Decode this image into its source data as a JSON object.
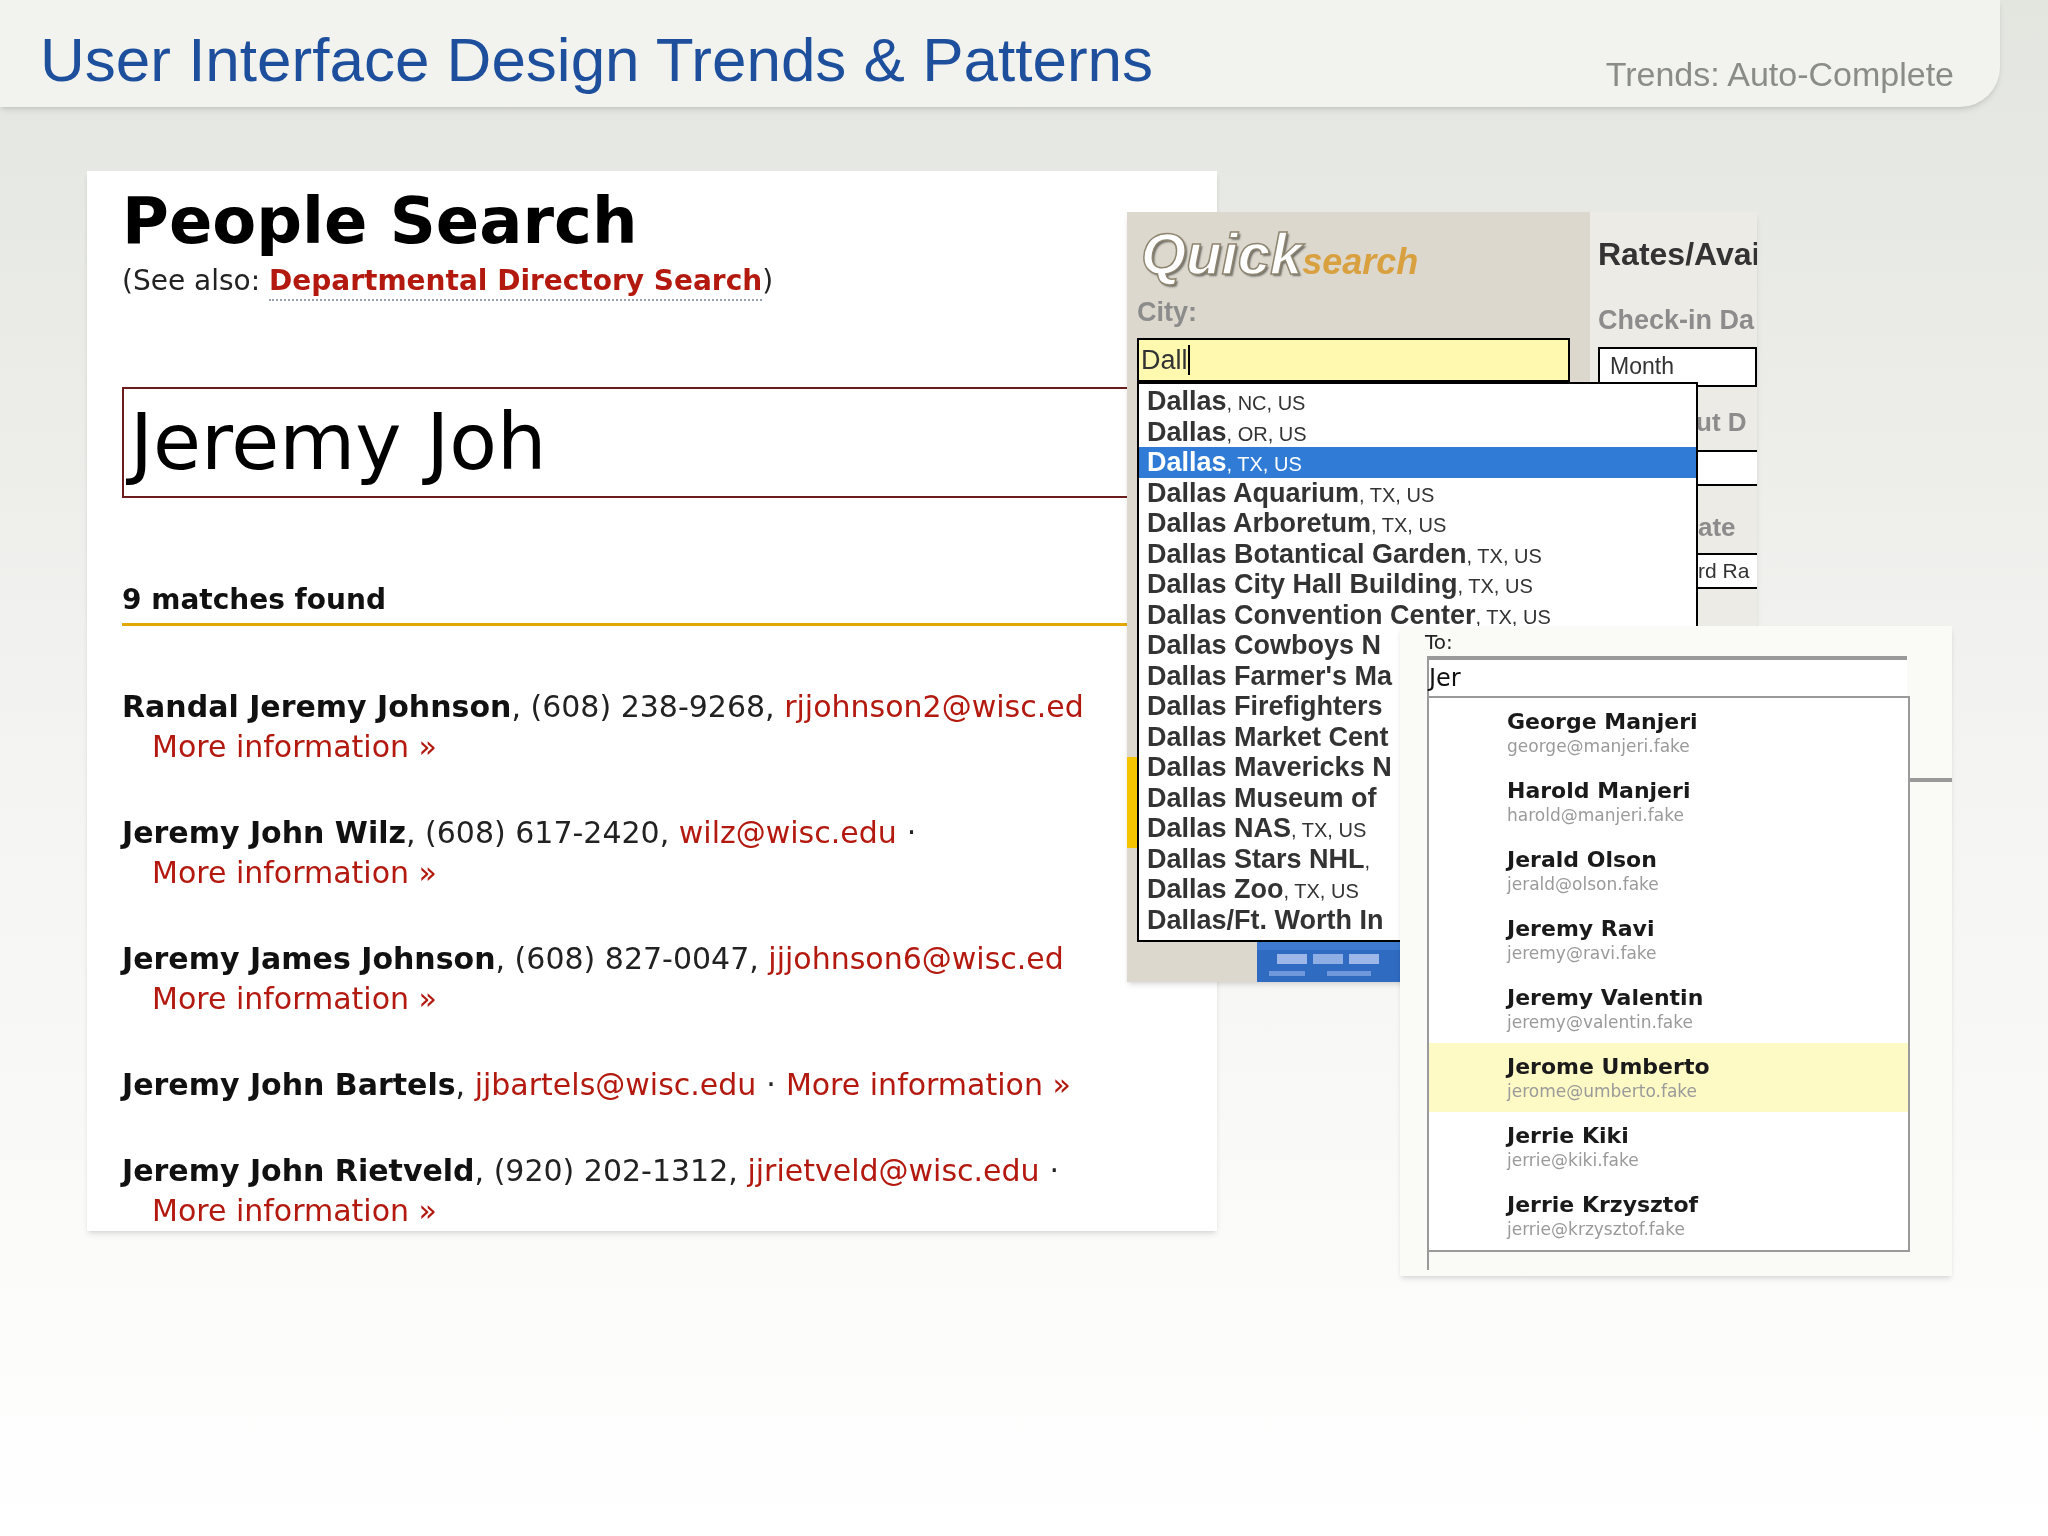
{
  "slide": {
    "title": "User Interface Design Trends & Patterns",
    "subtitle": "Trends: Auto-Complete"
  },
  "people_search": {
    "heading": "People Search",
    "see_also_open": "(See also: ",
    "see_also_link": "Departmental Directory Search",
    "see_also_close": ")",
    "query": "Jeremy Joh",
    "match_count": "9 matches found",
    "results": [
      {
        "name": "Randal Jeremy Johnson",
        "details": ", (608) 238-9268, ",
        "email": "rjjohnson2@wisc.ed",
        "more": "More information »",
        "more_on_new_line": true
      },
      {
        "name": "Jeremy John Wilz",
        "details": ", (608) 617-2420, ",
        "email": "wilz@wisc.edu",
        "separator": "·",
        "more": "More information »",
        "more_on_new_line": true
      },
      {
        "name": "Jeremy James Johnson",
        "details": ", (608) 827-0047, ",
        "email": "jjjohnson6@wisc.ed",
        "more": "More information »",
        "more_on_new_line": true
      },
      {
        "name": "Jeremy John Bartels",
        "details": ", ",
        "email": "jjbartels@wisc.edu",
        "separator": "·",
        "more": "More information »",
        "more_on_new_line": false
      },
      {
        "name": "Jeremy John Rietveld",
        "details": ", (920) 202-1312, ",
        "email": "jjrietveld@wisc.edu",
        "separator": "·",
        "more": "More information »",
        "more_on_new_line": true
      }
    ]
  },
  "quick_search": {
    "logo_main": "Quick",
    "logo_sub": "search",
    "city_label": "City:",
    "city_value": "Dall",
    "suggestions": [
      {
        "place": "Dallas",
        "region": ", NC, US",
        "selected": false
      },
      {
        "place": "Dallas",
        "region": ", OR, US",
        "selected": false
      },
      {
        "place": "Dallas",
        "region": ", TX, US",
        "selected": true
      },
      {
        "place": "Dallas Aquarium",
        "region": ", TX, US",
        "selected": false
      },
      {
        "place": "Dallas Arboretum",
        "region": ", TX, US",
        "selected": false
      },
      {
        "place": "Dallas Botantical Garden",
        "region": ", TX, US",
        "selected": false
      },
      {
        "place": "Dallas City Hall Building",
        "region": ", TX, US",
        "selected": false
      },
      {
        "place": "Dallas Convention Center",
        "region": ", TX, US",
        "selected": false
      },
      {
        "place": "Dallas Cowboys N",
        "selected": false
      },
      {
        "place": "Dallas Farmer's Ma",
        "selected": false
      },
      {
        "place": "Dallas Firefighters",
        "selected": false
      },
      {
        "place": "Dallas Market Cent",
        "selected": false
      },
      {
        "place": "Dallas Mavericks N",
        "selected": false
      },
      {
        "place": "Dallas Museum of",
        "selected": false
      },
      {
        "place": "Dallas NAS",
        "region": ", TX, US",
        "selected": false
      },
      {
        "place": "Dallas Stars NHL",
        "region": ",",
        "selected": false
      },
      {
        "place": "Dallas Zoo",
        "region": ", TX, US",
        "selected": false
      },
      {
        "place": "Dallas/Ft. Worth In",
        "selected": false
      }
    ],
    "rates": {
      "title": "Rates/Avai",
      "checkin_label": "Check-in Da",
      "checkin_field": "Month",
      "checkout_label": "ut D",
      "rate_label": "ate",
      "rate_field": "rd Ra"
    }
  },
  "mail": {
    "to_label": "To:",
    "to_value": "Jer",
    "contacts": [
      {
        "name": "George Manjeri",
        "email": "george@manjeri.fake",
        "selected": false
      },
      {
        "name": "Harold Manjeri",
        "email": "harold@manjeri.fake",
        "selected": false
      },
      {
        "name": "Jerald Olson",
        "email": "jerald@olson.fake",
        "selected": false
      },
      {
        "name": "Jeremy Ravi",
        "email": "jeremy@ravi.fake",
        "selected": false
      },
      {
        "name": "Jeremy Valentin",
        "email": "jeremy@valentin.fake",
        "selected": false
      },
      {
        "name": "Jerome Umberto",
        "email": "jerome@umberto.fake",
        "selected": true
      },
      {
        "name": "Jerrie Kiki",
        "email": "jerrie@kiki.fake",
        "selected": false
      },
      {
        "name": "Jerrie Krzysztof",
        "email": "jerrie@krzysztof.fake",
        "selected": false
      }
    ]
  }
}
